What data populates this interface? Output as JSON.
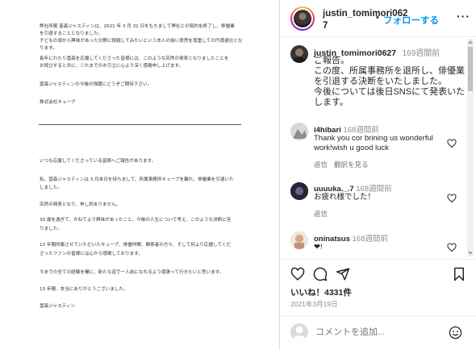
{
  "document": {
    "notice_lines": [
      "弊社所属 富森ジャスティンは、2021 年 3 月 31 日をもちまして弊社との契約を終了し、俳優業",
      "を引退することとなりました。",
      "子どもの頃から興味があった分野に挑戦してみたいという本人の強い意思を尊重しての円満退社とな",
      "ります。",
      "長年にわたり冨森を応援してくださった皆様には、このような突然の発表となりましたことを",
      "お詫びすると共に、これまでのお引立に心より深く感謝申し上げます。",
      "冨森ジャスティンの今後の飛躍にどうぞご期待下さい。",
      "株式会社キューブ"
    ],
    "message_lines": [
      "いつも応援してくださっている皆様へご報告があります。",
      "私、冨森ジャスティンは 3 月末日を持ちまして、所属事務所キューブを離れ、俳優業を引退いた",
      "しました。",
      "突然の発表となり、申し訳ありません。",
      "30 歳を過ぎて、かねてより興味があったこと、今後の人生について考え、このような決断に至",
      "りました。",
      "13 年間所属させていただいたキューブ、俳優仲間、関係者の方々、そして何より応援してくだ",
      "さったファンの皆様には心から感謝しております。",
      "今までの全ての経験を糧に、新たな道で一人前になれるよう頑張って行きたいと思います。",
      "13 年間、本当にありがとうございました。",
      "冨森ジャスティン"
    ]
  },
  "header": {
    "username_line1": "justin_tomimori062",
    "username_line2": "7",
    "follow_label": "フォローする",
    "follow_dot": "•",
    "more_icon": "more-horizontal-icon"
  },
  "caption": {
    "username": "justin_tomimori0627",
    "time": "169週間前",
    "lines": [
      "ご報告。",
      "この度、所属事務所を退所し、俳優業",
      "を引退する決断をいたしました。",
      "今後については後日SNSにて発表いた",
      "します。"
    ]
  },
  "comments": [
    {
      "username": "i4hibari",
      "time": "168週間前",
      "lines": [
        "Thank you cor brining us wonderful",
        "work!wish u good luck"
      ],
      "reply": "返信",
      "translate": "翻訳を見る"
    },
    {
      "username": "uuuuka._.7",
      "time": "168週間前",
      "lines": [
        "お疲れ様でした！"
      ],
      "reply": "返信"
    },
    {
      "username": "oninatsus",
      "time": "168週間前",
      "lines": [
        "❤!"
      ]
    }
  ],
  "actions": {
    "likes": "いいね！4331件",
    "date": "2021年3月19日"
  },
  "comment_box": {
    "placeholder": "コメントを追加..."
  },
  "colors": {
    "accent": "#0095f6",
    "text": "#262626",
    "muted": "#8e8e8e",
    "border": "#dbdbdb"
  }
}
